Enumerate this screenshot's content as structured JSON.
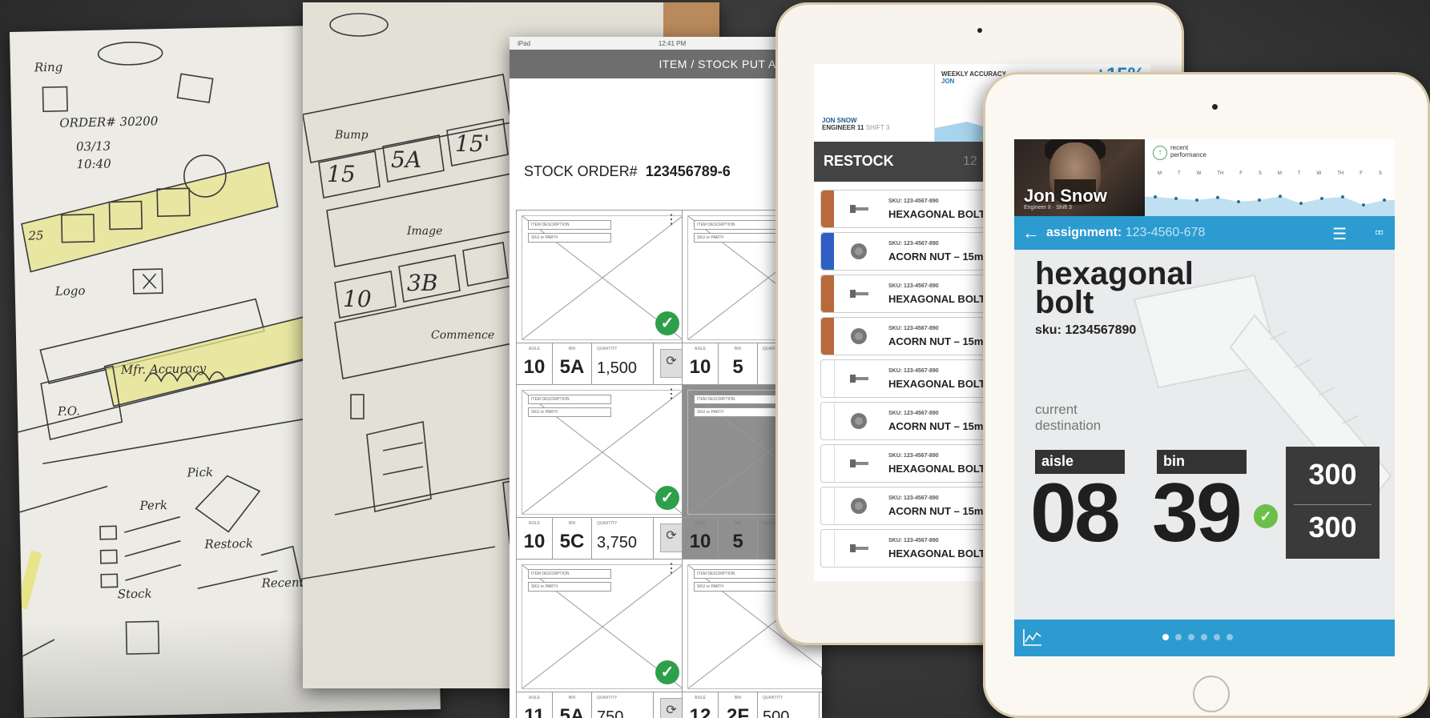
{
  "sketch_sheet_1": {
    "notes": [
      "Ring",
      "ORDER# 30200",
      "03/13",
      "10:40",
      "Perk",
      "Stock",
      "Restock",
      "Pick",
      "Logo",
      "25",
      "Mfr. Accuracy",
      "P.O.",
      "Recent"
    ]
  },
  "sketch_sheet_2": {
    "notes": [
      "15",
      "5A",
      "15'",
      "3B",
      "10",
      "Bump",
      "Image",
      "Commence"
    ]
  },
  "wireframe": {
    "status_left": "iPad",
    "status_time": "12:41 PM",
    "header_title": "ITEM / STOCK PUT AWAY",
    "order_label": "STOCK ORDER#",
    "order_number": "123456789-6",
    "tag_description": "ITEM DESCRIPTION",
    "tag_sku": "SKU or PART#",
    "label_aisle": "AISLE",
    "label_bin": "BIN",
    "label_quantity": "QUANTITY",
    "label_update": "UPDATE",
    "cards": [
      {
        "aisle": "10",
        "bin": "5A",
        "quantity": "1,500",
        "checked": true
      },
      {
        "aisle": "10",
        "bin": "5",
        "quantity": "",
        "checked": false
      },
      {
        "aisle": "10",
        "bin": "5C",
        "quantity": "3,750",
        "checked": true
      },
      {
        "aisle": "10",
        "bin": "5",
        "quantity": "",
        "checked": false
      },
      {
        "aisle": "11",
        "bin": "5A",
        "quantity": "750",
        "checked": true
      },
      {
        "aisle": "12",
        "bin": "2F",
        "quantity": "500",
        "checked": true
      }
    ]
  },
  "restock_tablet": {
    "user_name": "JON SNOW",
    "user_role": "ENGINEER 11",
    "user_shift": "SHIFT 3",
    "weekly_title": "WEEKLY ACCURACY",
    "weekly_sub": "JON",
    "weekly_change": "+15%",
    "section_title": "RESTOCK",
    "section_number": "12",
    "rows": [
      {
        "sku": "SKU: 123-4567-890",
        "name": "HEXAGONAL BOLT",
        "strip": "#b86a3a",
        "icon": "bolt"
      },
      {
        "sku": "SKU: 123-4567-890",
        "name": "ACORN NUT – 15m",
        "strip": "#2f5fc4",
        "icon": "nut"
      },
      {
        "sku": "SKU: 123-4567-890",
        "name": "HEXAGONAL BOLT",
        "strip": "#b86a3a",
        "icon": "bolt"
      },
      {
        "sku": "SKU: 123-4567-890",
        "name": "ACORN NUT – 15m",
        "strip": "#b86a3a",
        "icon": "nut"
      },
      {
        "sku": "SKU: 123-4567-890",
        "name": "HEXAGONAL BOLT",
        "strip": "#ffffff",
        "icon": "bolt"
      },
      {
        "sku": "SKU: 123-4567-890",
        "name": "ACORN NUT – 15m",
        "strip": "#ffffff",
        "icon": "nut"
      },
      {
        "sku": "SKU: 123-4567-890",
        "name": "HEXAGONAL BOLT",
        "strip": "#ffffff",
        "icon": "bolt"
      },
      {
        "sku": "SKU: 123-4567-890",
        "name": "ACORN NUT – 15m",
        "strip": "#ffffff",
        "icon": "nut"
      },
      {
        "sku": "SKU: 123-4567-890",
        "name": "HEXAGONAL BOLT",
        "strip": "#ffffff",
        "icon": "bolt"
      }
    ]
  },
  "assignment_tablet": {
    "user_name": "Jon Snow",
    "user_role": "Engineer II · Shift 3",
    "perf_line1": "recent",
    "perf_line2": "performance",
    "days": [
      "M",
      "T",
      "W",
      "TH",
      "F",
      "S",
      "M",
      "T",
      "W",
      "TH",
      "F",
      "S"
    ],
    "perf_values": [
      0.6,
      0.55,
      0.5,
      0.58,
      0.45,
      0.5,
      0.62,
      0.4,
      0.55,
      0.6,
      0.35,
      0.5
    ],
    "nav_back": "←",
    "nav_label": "assignment:",
    "nav_value": "123-4560-678",
    "item_line1": "hexagonal",
    "item_line2": "bolt",
    "item_sku": "sku: 1234567890",
    "destination_line1": "current",
    "destination_line2": "destination",
    "aisle_label": "aisle",
    "bin_label": "bin",
    "aisle_value": "08",
    "bin_value": "39",
    "qty_top": "300",
    "qty_bottom": "300",
    "page_dots": 6,
    "page_active": 0,
    "accent_color": "#2c9bd0",
    "check_color": "#6cc04a"
  }
}
